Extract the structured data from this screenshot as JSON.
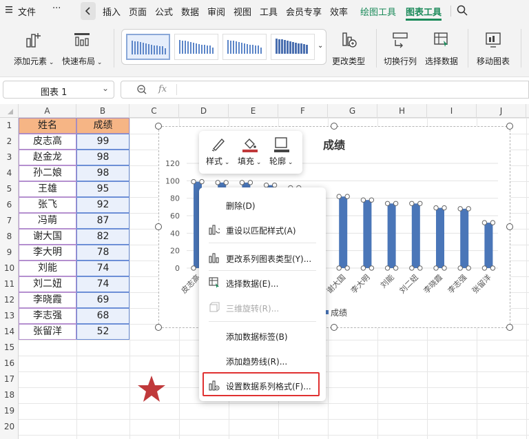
{
  "menubar": {
    "items": [
      "文件",
      "插入",
      "页面",
      "公式",
      "数据",
      "审阅",
      "视图",
      "工具",
      "会员专享",
      "效率",
      "绘图工具",
      "图表工具"
    ]
  },
  "ribbon": {
    "add_element": "添加元素",
    "quick_layout": "快速布局",
    "change_type": "更改类型",
    "switch_rowcol": "切换行列",
    "select_data": "选择数据",
    "move_chart": "移动图表"
  },
  "namebox": {
    "value": "图表 1"
  },
  "formula": {
    "fx": "fx"
  },
  "columns": [
    "A",
    "B",
    "C",
    "D",
    "E",
    "F",
    "G",
    "H",
    "I",
    "J"
  ],
  "rows": [
    "1",
    "2",
    "3",
    "4",
    "5",
    "6",
    "7",
    "8",
    "9",
    "10",
    "11",
    "12",
    "13",
    "14",
    "15",
    "16",
    "17",
    "18",
    "19",
    "20"
  ],
  "table": {
    "header_name": "姓名",
    "header_score": "成绩",
    "names": [
      "皮志高",
      "赵金龙",
      "孙二娘",
      "王雄",
      "张飞",
      "冯萌",
      "谢大国",
      "李大明",
      "刘能",
      "刘二妞",
      "李晓霞",
      "李志强",
      "张留洋"
    ],
    "scores": [
      "99",
      "98",
      "98",
      "95",
      "92",
      "87",
      "82",
      "78",
      "74",
      "74",
      "69",
      "68",
      "52"
    ]
  },
  "chart_data": {
    "type": "bar",
    "title": "成绩",
    "categories": [
      "皮志高",
      "赵金龙",
      "孙二娘",
      "王雄",
      "张飞",
      "冯萌",
      "谢大国",
      "李大明",
      "刘能",
      "刘二妞",
      "李晓霞",
      "李志强",
      "张留洋"
    ],
    "series": [
      {
        "name": "成绩",
        "values": [
          99,
          98,
          98,
          95,
          92,
          87,
          82,
          78,
          74,
          74,
          69,
          68,
          52
        ],
        "color": "#4a76b8"
      }
    ],
    "yticks": [
      "0",
      "20",
      "40",
      "60",
      "80",
      "100",
      "120"
    ],
    "ylim": [
      0,
      120
    ],
    "grid": true,
    "legend": "bottom",
    "visible_xlabels": [
      "皮志高",
      "谢大国",
      "李大明",
      "刘能",
      "刘二妞",
      "李晓霞",
      "李志强",
      "张留洋"
    ]
  },
  "minitoolbar": {
    "style": "样式",
    "fill": "填充",
    "outline": "轮廓"
  },
  "contextmenu": {
    "items": [
      {
        "label": "删除(D)",
        "disabled": false
      },
      {
        "label": "重设以匹配样式(A)",
        "disabled": false
      },
      {
        "label": "更改系列图表类型(Y)...",
        "disabled": false
      },
      {
        "label": "选择数据(E)...",
        "disabled": false
      },
      {
        "label": "三维旋转(R)...",
        "disabled": true
      },
      {
        "label": "添加数据标签(B)",
        "disabled": false
      },
      {
        "label": "添加趋势线(R)...",
        "disabled": false
      },
      {
        "label": "设置数据系列格式(F)...",
        "disabled": false
      }
    ]
  },
  "colors": {
    "accent": "#1b8a5a",
    "bar": "#4a76b8",
    "header_fill": "#f6b585",
    "highlight": "#e03030",
    "star": "#c0393b"
  }
}
